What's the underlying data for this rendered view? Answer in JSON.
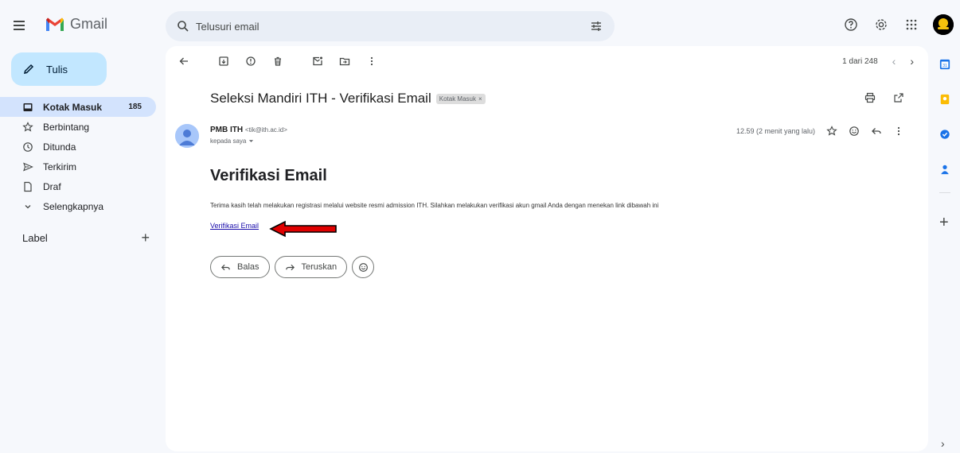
{
  "app": {
    "name": "Gmail"
  },
  "search": {
    "placeholder": "Telusuri email"
  },
  "compose": {
    "label": "Tulis"
  },
  "sidebar": {
    "items": [
      {
        "label": "Kotak Masuk",
        "count": "185",
        "icon": "inbox-icon",
        "active": true
      },
      {
        "label": "Berbintang",
        "count": "",
        "icon": "star-icon"
      },
      {
        "label": "Ditunda",
        "count": "",
        "icon": "clock-icon"
      },
      {
        "label": "Terkirim",
        "count": "",
        "icon": "send-icon"
      },
      {
        "label": "Draf",
        "count": "",
        "icon": "draft-icon"
      },
      {
        "label": "Selengkapnya",
        "count": "",
        "icon": "chevron-down-icon"
      }
    ],
    "label_heading": "Label"
  },
  "toolbar": {
    "pagination": "1 dari 248"
  },
  "email": {
    "subject": "Seleksi Mandiri ITH - Verifikasi Email",
    "label_chip": "Kotak Masuk",
    "sender_name": "PMB ITH",
    "sender_email": "<tik@ith.ac.id>",
    "recipient": "kepada saya",
    "timestamp": "12.59 (2 menit yang lalu)",
    "body_title": "Verifikasi Email",
    "body_text": "Terima kasih telah melakukan registrasi melalui website resmi admission ITH. Silahkan melakukan verifikasi akun gmail Anda dengan menekan link dibawah ini",
    "link_text": "Verifikasi Email"
  },
  "reply_actions": {
    "reply": "Balas",
    "forward": "Teruskan"
  },
  "colors": {
    "background": "#f6f8fc",
    "compose": "#c2e7ff",
    "active_nav": "#d3e3fd",
    "annotation_arrow": "#e00000"
  }
}
